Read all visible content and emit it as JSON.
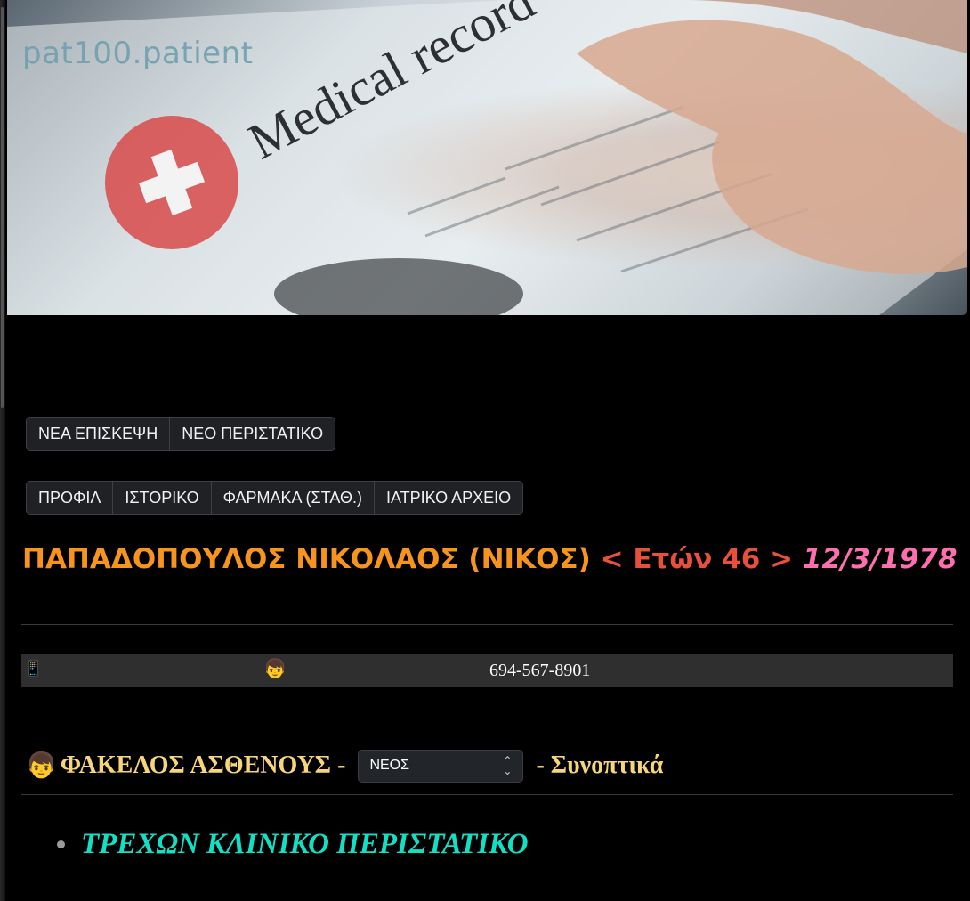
{
  "app": {
    "brand": "pat100.patient"
  },
  "actions": {
    "new_visit": "ΝΕΑ ΕΠΙΣΚΕΨΗ",
    "new_case": "ΝΕΟ ΠΕΡΙΣΤΑΤΙΚΟ"
  },
  "tabs": [
    {
      "label": "ΠΡΟΦΙΛ"
    },
    {
      "label": "ΙΣΤΟΡΙΚΟ"
    },
    {
      "label": "ΦΑΡΜΑΚΑ (ΣΤΑΘ.)"
    },
    {
      "label": "ΙΑΤΡΙΚΟ ΑΡΧΕΙΟ"
    }
  ],
  "patient": {
    "name": "ΠΑΠΑΔΟΠΟΥΛΟΣ ΝΙΚΟΛΑΟΣ (ΝΙΚΟΣ)",
    "age_text": "< Ετών 46 >",
    "dob": "12/3/1978"
  },
  "contact": {
    "phone_icon": "📱",
    "face_icon": "👦",
    "phone": "694-567-8901"
  },
  "folder": {
    "icon": "👦",
    "title": "ΦΑΚΕΛΟΣ ΑΣΘΕΝΟΥΣ -",
    "status_value": "ΝΕΟΣ",
    "suffix": "- Συνοπτικά"
  },
  "section": {
    "current_case": "ΤΡΕΧΩΝ ΚΛΙΝΙΚΟ ΠΕΡΙΣΤΑΤΙΚΟ"
  }
}
